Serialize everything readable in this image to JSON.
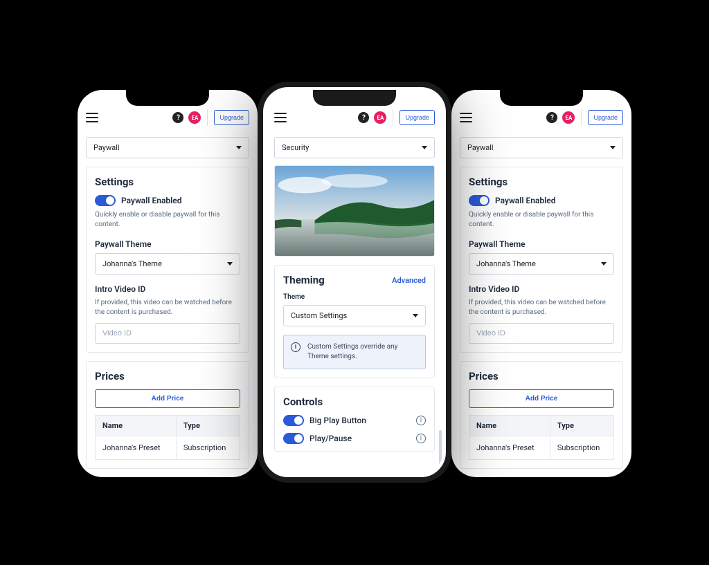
{
  "topbar": {
    "avatar_initials": "EA",
    "upgrade_label": "Upgrade"
  },
  "side_screen": {
    "section_picker": "Paywall",
    "settings_title": "Settings",
    "paywall_enabled_label": "Paywall Enabled",
    "paywall_enabled_help": "Quickly enable or disable paywall for this content.",
    "theme_label": "Paywall Theme",
    "theme_value": "Johanna's Theme",
    "intro_video_label": "Intro Video ID",
    "intro_video_help": "If provided, this video can be watched before the content is purchased.",
    "intro_video_placeholder": "Video ID",
    "prices_title": "Prices",
    "add_price_label": "Add Price",
    "price_table": {
      "col_name": "Name",
      "col_type": "Type",
      "row0_name": "Johanna's Preset",
      "row0_type": "Subscription"
    }
  },
  "center_screen": {
    "section_picker": "Security",
    "theming_title": "Theming",
    "advanced_link": "Advanced",
    "theme_small_label": "Theme",
    "theme_value": "Custom Settings",
    "info_banner": "Custom Settings override any Theme settings.",
    "controls_title": "Controls",
    "control_big_play": "Big Play Button",
    "control_play_pause": "Play/Pause"
  }
}
